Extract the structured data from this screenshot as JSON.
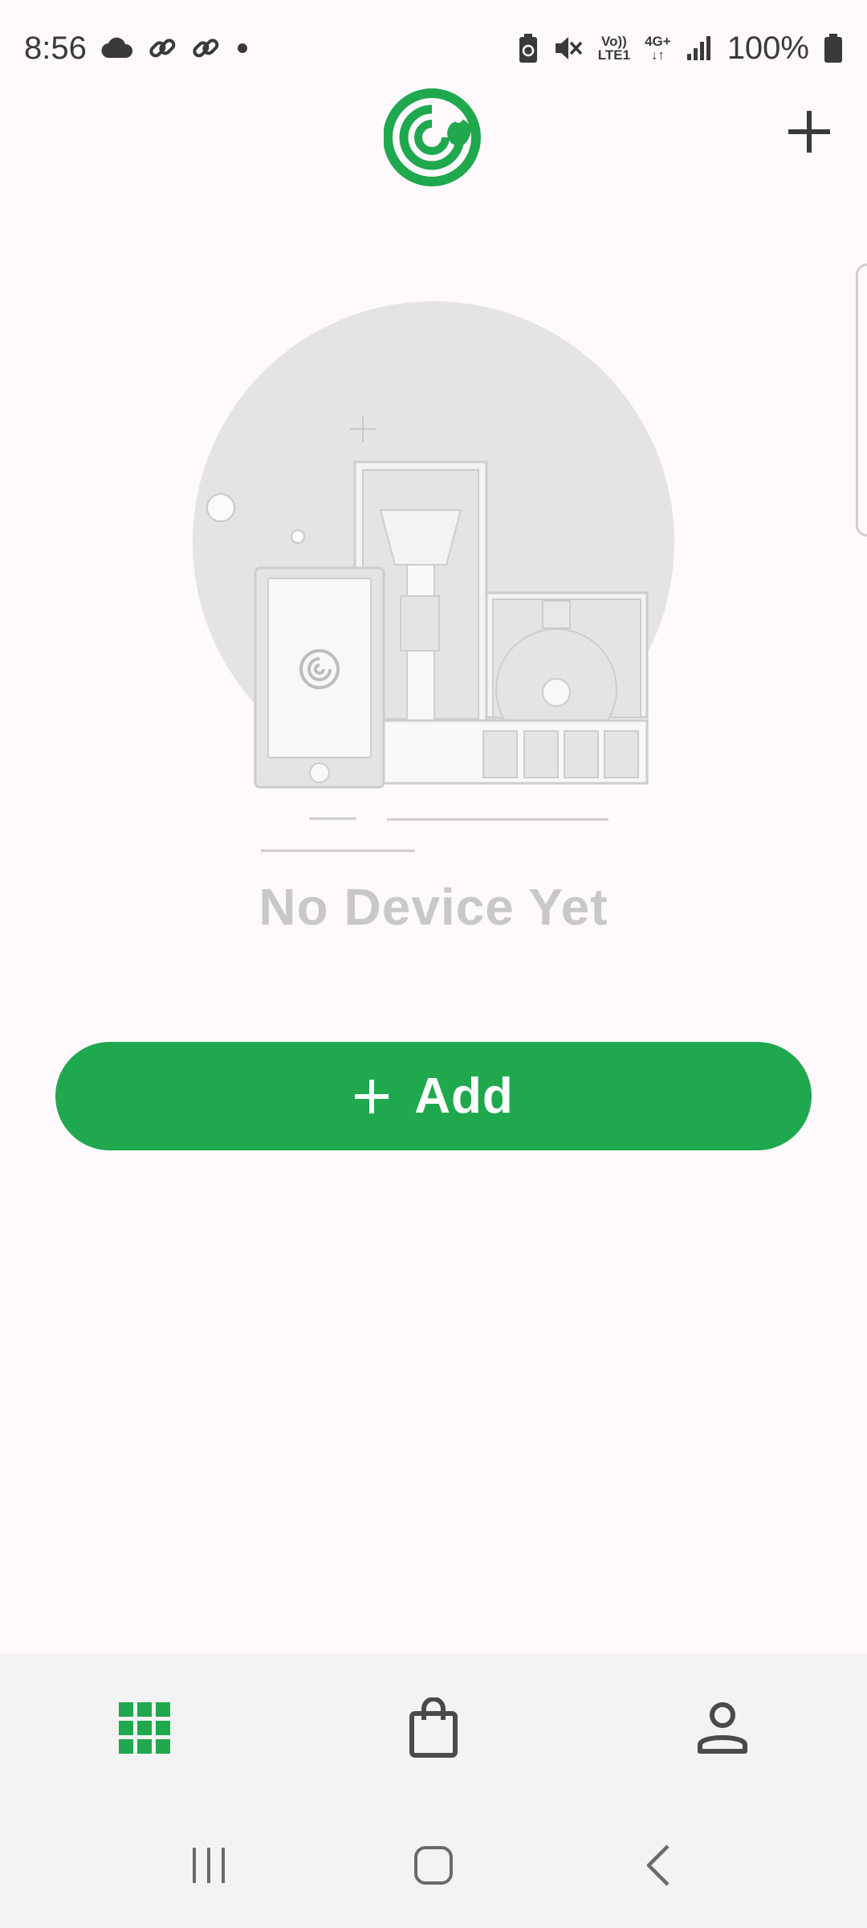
{
  "status_bar": {
    "time": "8:56",
    "battery_percent": "100%",
    "volte_label_top": "Vo))",
    "volte_label_bottom": "LTE1",
    "network_label": "4G+",
    "icons": [
      "cloud-icon",
      "link-icon",
      "link-icon",
      "dot-icon",
      "battery-saver-icon",
      "mute-icon",
      "signal-icon",
      "battery-icon"
    ]
  },
  "header": {
    "logo": "app-logo",
    "add_icon": "plus-icon"
  },
  "empty_state": {
    "title": "No Device Yet",
    "illustration": "devices-illustration"
  },
  "add_button": {
    "label": "Add",
    "icon": "plus-icon"
  },
  "bottom_nav": {
    "items": [
      {
        "name": "devices",
        "icon": "grid-icon",
        "active": true
      },
      {
        "name": "shop",
        "icon": "shopping-bag-icon",
        "active": false
      },
      {
        "name": "profile",
        "icon": "person-icon",
        "active": false
      }
    ]
  },
  "system_nav": {
    "items": [
      "recents-icon",
      "home-icon",
      "back-icon"
    ]
  },
  "colors": {
    "accent": "#1fa84e",
    "background": "#fdf9fc",
    "nav_background": "#f3f3f3",
    "muted_text": "#c8c8c8",
    "icon_dark": "#3a3a3a"
  }
}
